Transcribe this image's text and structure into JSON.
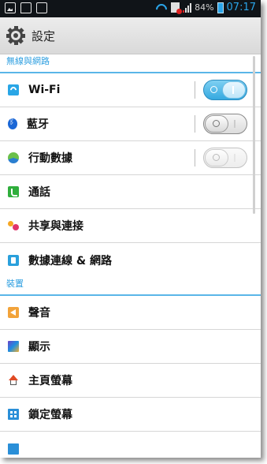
{
  "status_bar": {
    "battery": "84%",
    "time": "07:17",
    "icons": [
      "gallery-icon",
      "message-icon",
      "sd-card-icon",
      "wifi-icon",
      "no-sim-icon",
      "signal-icon",
      "battery-icon"
    ]
  },
  "header": {
    "title": "設定",
    "icon": "gear-icon"
  },
  "sections": {
    "wireless": "無線與網路",
    "device": "裝置"
  },
  "rows": {
    "wifi": {
      "label": "Wi-Fi",
      "icon": "wifi-icon",
      "toggle": "on"
    },
    "bluetooth": {
      "label": "藍牙",
      "icon": "bluetooth-icon",
      "toggle": "off"
    },
    "mobile_data": {
      "label": "行動數據",
      "icon": "mobile-data-icon",
      "toggle": "disabled"
    },
    "call": {
      "label": "通話",
      "icon": "phone-icon"
    },
    "share": {
      "label": "共享與連接",
      "icon": "share-icon"
    },
    "tethering": {
      "label": "數據連線 & 網路",
      "icon": "tethering-icon"
    },
    "sound": {
      "label": "聲音",
      "icon": "sound-icon"
    },
    "display": {
      "label": "顯示",
      "icon": "display-icon"
    },
    "home_screen": {
      "label": "主頁螢幕",
      "icon": "home-icon"
    },
    "lock_screen": {
      "label": "鎖定螢幕",
      "icon": "lock-screen-icon"
    }
  },
  "colors": {
    "accent": "#2e9fe0",
    "status_bar_bg": "#101418",
    "toggle_on": "#35a9e0"
  }
}
